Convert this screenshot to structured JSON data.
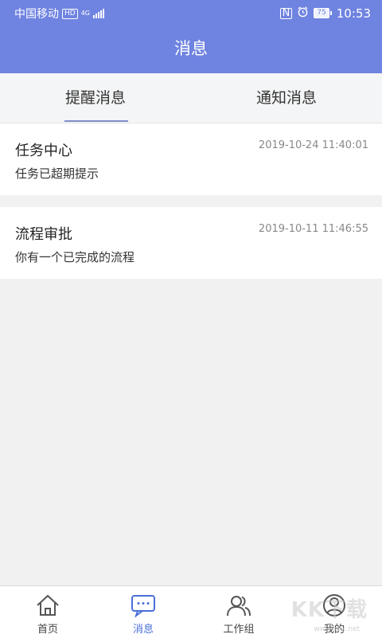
{
  "status": {
    "carrier": "中国移动",
    "hd": "HD",
    "net": "4G",
    "battery": "75",
    "time": "10:53"
  },
  "header": {
    "title": "消息"
  },
  "tabs": [
    {
      "label": "提醒消息",
      "active": true
    },
    {
      "label": "通知消息",
      "active": false
    }
  ],
  "messages": [
    {
      "title": "任务中心",
      "time": "2019-10-24 11:40:01",
      "desc": "任务已超期提示"
    },
    {
      "title": "流程审批",
      "time": "2019-10-11 11:46:55",
      "desc": "你有一个已完成的流程"
    }
  ],
  "nav": [
    {
      "label": "首页",
      "icon": "home-icon"
    },
    {
      "label": "消息",
      "icon": "message-icon",
      "active": true
    },
    {
      "label": "工作组",
      "icon": "group-icon"
    },
    {
      "label": "我的",
      "icon": "profile-icon"
    }
  ],
  "watermark": {
    "text": "KK下载",
    "url": "www.kkx.net"
  },
  "colors": {
    "primary": "#6f83e0",
    "active_nav": "#4a6fd8"
  }
}
